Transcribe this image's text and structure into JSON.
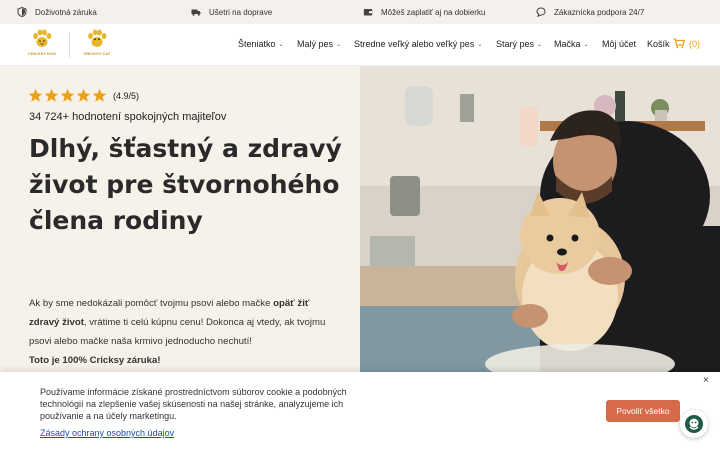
{
  "topbar": {
    "items": [
      {
        "icon": "shield-icon",
        "label": "Doživotná záruka"
      },
      {
        "icon": "truck-icon",
        "label": "Ušetri na doprave"
      },
      {
        "icon": "wallet-icon",
        "label": "Môžeš zaplatiť aj na dobierku"
      },
      {
        "icon": "chat-icon",
        "label": "Zákaznícka podpora 24/7"
      }
    ]
  },
  "header": {
    "logos": [
      {
        "name": "Cricksy Dog",
        "text": "CRICKSY DOG"
      },
      {
        "name": "Cricksy Cat",
        "text": "CRICKSY CAT"
      }
    ],
    "nav": [
      {
        "label": "Šteniatko",
        "dropdown": true
      },
      {
        "label": "Malý pes",
        "dropdown": true
      },
      {
        "label": "Stredne veľký alebo veľký pes",
        "dropdown": true
      },
      {
        "label": "Starý pes",
        "dropdown": true
      },
      {
        "label": "Mačka",
        "dropdown": true
      },
      {
        "label": "Môj účet",
        "dropdown": false
      },
      {
        "label": "Košík",
        "dropdown": false
      }
    ],
    "cart_count": "(0)"
  },
  "hero": {
    "stars": 5,
    "rating": "(4.9/5)",
    "reviews": "34 724+ hodnotení spokojných majiteľov",
    "headline": "Dlhý, šťastný a zdravý život pre štvornohého člena rodiny",
    "para_1": "Ak by sme nedokázali pomôcť tvojmu psovi alebo mačke ",
    "para_bold": "opäť žiť zdravý život",
    "para_2": ", vrátime ti celú kúpnu cenu! Dokonca aj vtedy, ak tvojmu psovi alebo mačke naša krmivo jednoducho nechutí!",
    "para_guarantee": "Toto je 100% Cricksy záruka!",
    "image_alt": "Muž drží malého psíka Pomeranian v kuchyni"
  },
  "cookie": {
    "text": "Používame informácie získané prostredníctvom súborov cookie a podobných technológií na zlepšenie vašej skúsenosti na našej stránke, analyzujeme ich používanie a na účely marketingu.",
    "link": "Zásady ochrany osobných údajov",
    "button": "Povoliť všetko",
    "close": "×"
  },
  "colors": {
    "accent": "#e9a215",
    "cookie_button": "#d86a4a",
    "hero_bg": "#f6f2ea",
    "topbar_bg": "#f4f1ec",
    "link": "#1e4fa6"
  }
}
